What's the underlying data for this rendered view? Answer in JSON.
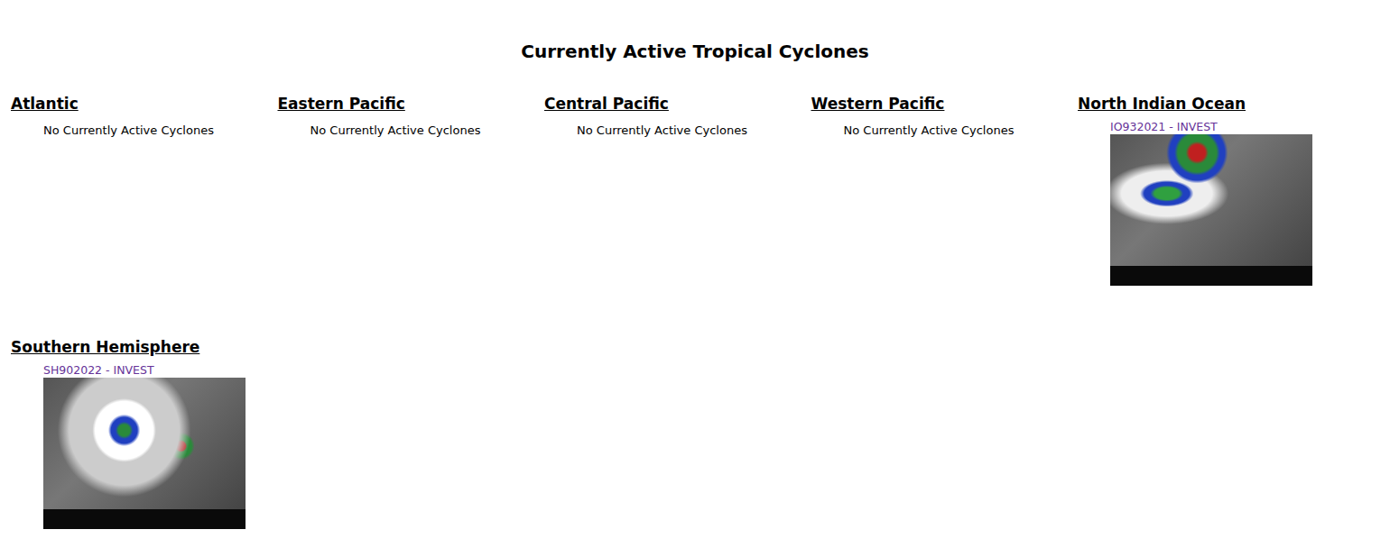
{
  "page": {
    "title": "Currently Active Tropical Cyclones"
  },
  "regions": [
    {
      "name": "Atlantic",
      "message": "No Currently Active Cyclones",
      "storms": []
    },
    {
      "name": "Eastern Pacific",
      "message": "No Currently Active Cyclones",
      "storms": []
    },
    {
      "name": "Central Pacific",
      "message": "No Currently Active Cyclones",
      "storms": []
    },
    {
      "name": "Western Pacific",
      "message": "No Currently Active Cyclones",
      "storms": []
    },
    {
      "name": "North Indian Ocean",
      "message": "",
      "storms": [
        {
          "label": "IO932021 - INVEST"
        }
      ]
    },
    {
      "name": "Southern Hemisphere",
      "message": "",
      "storms": [
        {
          "label": "SH902022 - INVEST"
        }
      ]
    }
  ]
}
